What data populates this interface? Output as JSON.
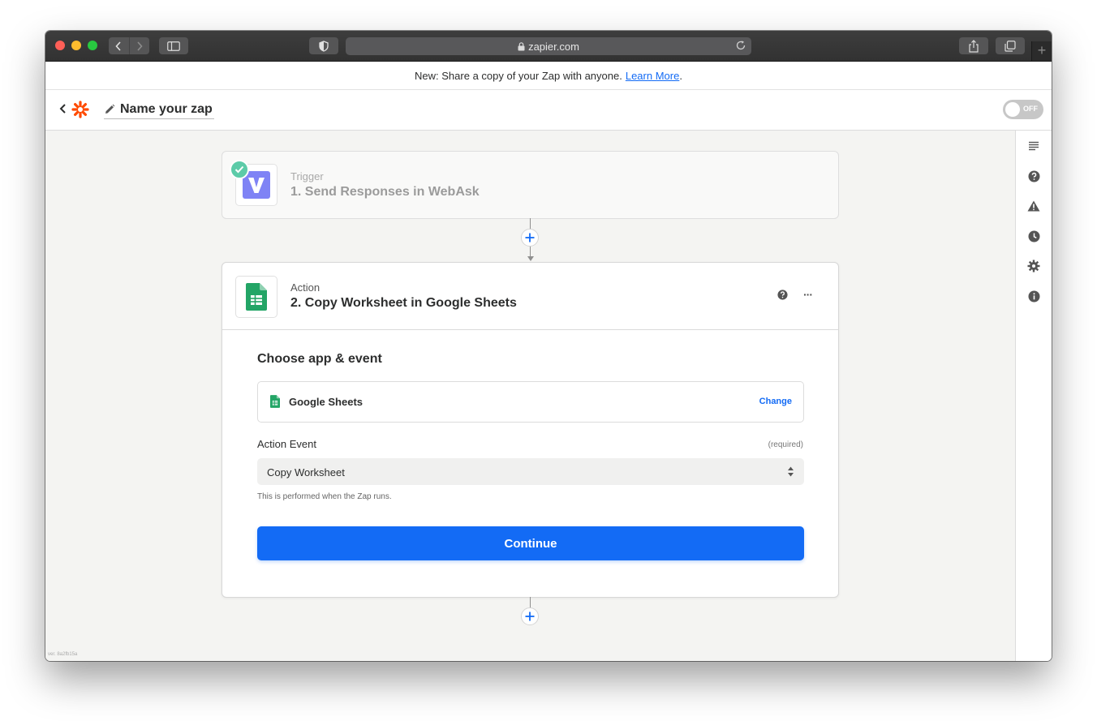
{
  "browser": {
    "url": "zapier.com"
  },
  "announcement": {
    "text": "New: Share a copy of your Zap with anyone.",
    "link": "Learn More",
    "suffix": "."
  },
  "header": {
    "zap_name": "Name your zap",
    "toggle_label": "OFF"
  },
  "trigger": {
    "type": "Trigger",
    "title": "1. Send Responses in WebAsk",
    "icon": "webask-logo-icon",
    "status": "complete"
  },
  "action": {
    "type": "Action",
    "title": "2. Copy Worksheet in Google Sheets",
    "icon": "google-sheets-icon",
    "section_title": "Choose app & event",
    "app_name": "Google Sheets",
    "change_label": "Change",
    "event_label": "Action Event",
    "required_label": "(required)",
    "event_value": "Copy Worksheet",
    "event_help": "This is performed when the Zap runs.",
    "continue_label": "Continue"
  },
  "right_rail": [
    "outline-icon",
    "help-icon",
    "warning-icon",
    "history-icon",
    "settings-icon",
    "info-icon"
  ],
  "version": "ver. 8a2fb15a",
  "colors": {
    "accent": "#136bf5",
    "zapier_orange": "#ff4a00",
    "success": "#5ccba8",
    "sheets_green": "#23a566",
    "webask_purple": "#7f83f5"
  }
}
